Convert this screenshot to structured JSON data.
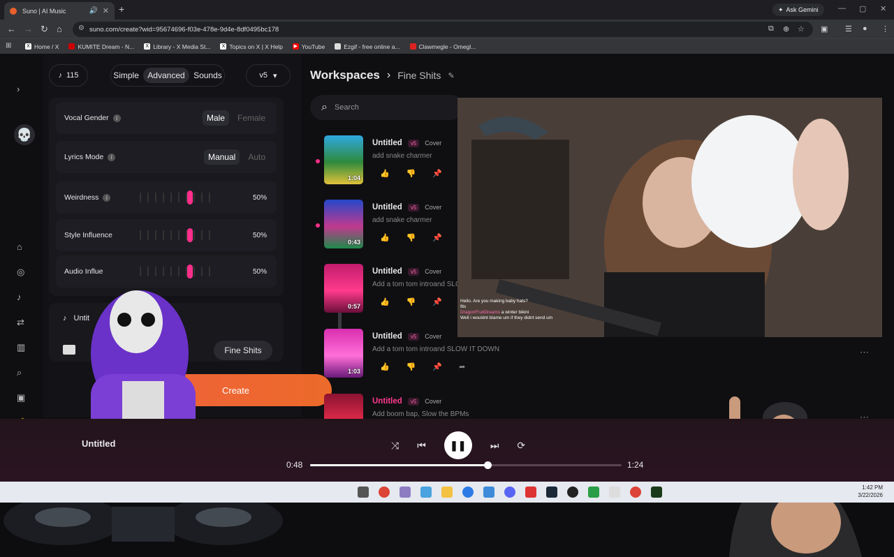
{
  "browser": {
    "tab_title": "Suno | AI Music",
    "url": "suno.com/create?wid=95674696-f03e-478e-9d4e-8df0495bc178",
    "gemini_label": "Ask Gemini",
    "bookmarks": [
      "Home / X",
      "KUMITE Dream - N...",
      "Library - X Media St...",
      "Topics on X | X Help",
      "YouTube",
      "Ezgif - free online a...",
      "Clawmegle - Omegl..."
    ]
  },
  "panel": {
    "credits": "115",
    "modes": [
      "Simple",
      "Advanced",
      "Sounds"
    ],
    "active_mode": "Advanced",
    "version": "v5",
    "vocal_gender": {
      "label": "Vocal Gender",
      "options": [
        "Male",
        "Female"
      ],
      "selected": "Male"
    },
    "lyrics_mode": {
      "label": "Lyrics Mode",
      "options": [
        "Manual",
        "Auto"
      ],
      "selected": "Manual"
    },
    "weirdness": {
      "label": "Weirdness",
      "value": "50%"
    },
    "style_influence": {
      "label": "Style Influence",
      "value": "50%"
    },
    "audio_influence": {
      "label": "Audio Influe",
      "value": "50%"
    },
    "song_title": "Untit",
    "workspace_button": "Fine Shits",
    "create_label": "Create"
  },
  "workspace": {
    "title": "Workspaces",
    "current": "Fine Shits",
    "search_placeholder": "Search",
    "tracks": [
      {
        "title": "Untitled",
        "version": "v5",
        "tag": "Cover",
        "prompt": "add snake charmer",
        "duration": "1:04",
        "playing": true,
        "colors": [
          "#2fa8e0",
          "#2f8a3c",
          "#e0c23a"
        ]
      },
      {
        "title": "Untitled",
        "version": "v5",
        "tag": "Cover",
        "prompt": "add snake charmer",
        "duration": "0:43",
        "playing": true,
        "colors": [
          "#2448c9",
          "#c03a8f",
          "#1e8a4a"
        ]
      },
      {
        "title": "Untitled",
        "version": "v5",
        "tag": "Cover",
        "prompt": "Add a tom tom introand SLOW IT DOWN",
        "duration": "0:57",
        "playing": false,
        "colors": [
          "#c21d6d",
          "#ff3a8c",
          "#6b0f3a"
        ]
      },
      {
        "title": "Untitled",
        "version": "v5",
        "tag": "Cover",
        "prompt": "Add a tom tom introand SLOW IT DOWN",
        "duration": "1:03",
        "playing": false,
        "colors": [
          "#d92fb0",
          "#ff6fd8",
          "#6a1a7a"
        ]
      },
      {
        "title": "Untitled",
        "version": "v5",
        "tag": "Cover",
        "prompt": "Add boom bap, Slow the BPMs",
        "duration": "",
        "playing": false,
        "colors": [
          "#8a1230",
          "#e02a4a",
          "#2a0a14"
        ],
        "title_color": "#ff3a8c"
      }
    ]
  },
  "chat": [
    {
      "user": "",
      "msg": "Hello. Are you making baby hats?"
    },
    {
      "user": "",
      "msg": "fits"
    },
    {
      "user": "DragonFruitDreams",
      "msg": "a winter bikini"
    },
    {
      "user": "",
      "msg": "Well i wouldnt blame um if they didnt send um"
    }
  ],
  "player": {
    "title": "Untitled",
    "current_time": "0:48",
    "total_time": "1:24",
    "progress": 0.57
  },
  "taskbar": {
    "time": "1:42 PM",
    "date": "3/22/2026"
  }
}
